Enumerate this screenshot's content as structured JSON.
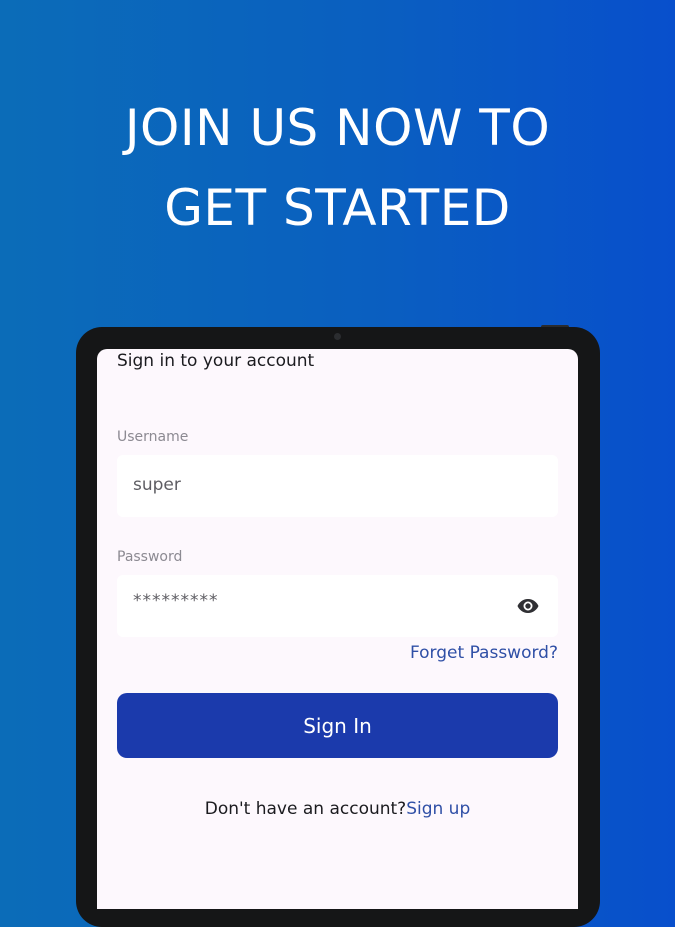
{
  "headline": {
    "line1": "JOIN US NOW TO",
    "line2": "GET STARTED"
  },
  "form": {
    "title": "Sign in to your account",
    "username_label": "Username",
    "username_value": "super",
    "password_label": "Password",
    "password_masked": "*********",
    "forgot_password": "Forget Password?",
    "sign_in_button": "Sign In",
    "no_account_text": "Don't have an account?",
    "sign_up_link": "Sign up"
  },
  "icons": {
    "password_toggle": "eye-icon"
  },
  "colors": {
    "background_start": "#0b6cb8",
    "background_end": "#084fcc",
    "primary_button": "#1b3aac",
    "link": "#2f4fa6",
    "screen_bg": "#fdf8fd"
  }
}
